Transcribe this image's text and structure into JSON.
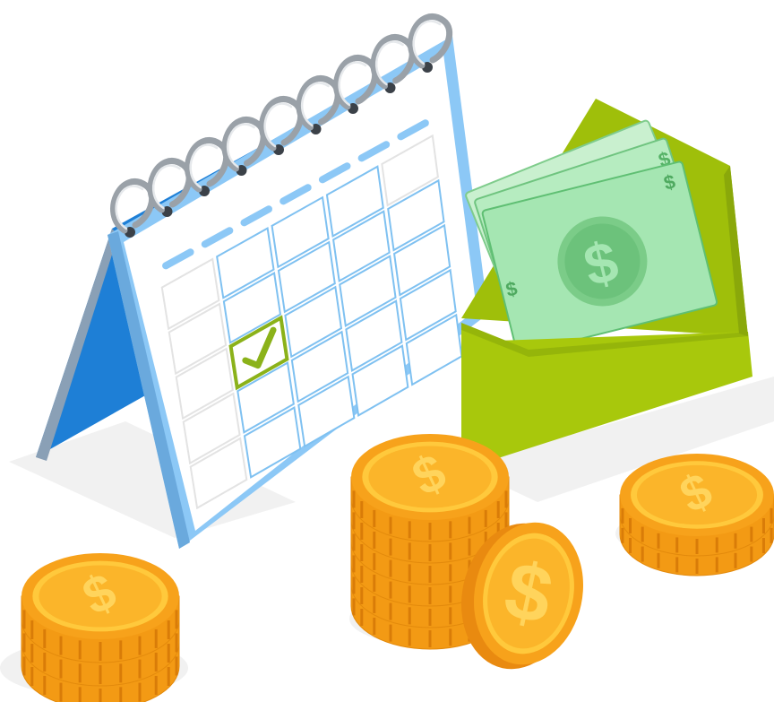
{
  "scene": {
    "icons": [
      "calendar-icon",
      "checkmark-icon",
      "envelope-icon",
      "banknote-icon",
      "dollar-coin-icon"
    ],
    "symbol": "$",
    "colors": {
      "calendar_blue": "#1e7fd6",
      "calendar_light_blue": "#8cc8f6",
      "calendar_frame": "#b7def9",
      "envelope_green": "#a8c80c",
      "envelope_dark": "#95b50a",
      "check_green": "#8bb21a",
      "cash_green": "#9de3ab",
      "cash_dark": "#5fbf73",
      "coin_orange": "#f7a21b",
      "coin_yellow": "#ffc93c",
      "coin_edge": "#e98a10",
      "ring_grey": "#9aa1a8",
      "shadow": "#f0f0f0"
    }
  },
  "calendar": {
    "rows": 5,
    "columns": 5,
    "checked_cell": [
      2,
      1
    ]
  },
  "banknotes": {
    "count": 3
  },
  "coin_stacks": [
    {
      "name": "left-stack",
      "coins": 3
    },
    {
      "name": "center-stack",
      "coins": 6
    },
    {
      "name": "right-stack",
      "coins": 2
    },
    {
      "name": "standing-coin",
      "coins": 1
    }
  ]
}
